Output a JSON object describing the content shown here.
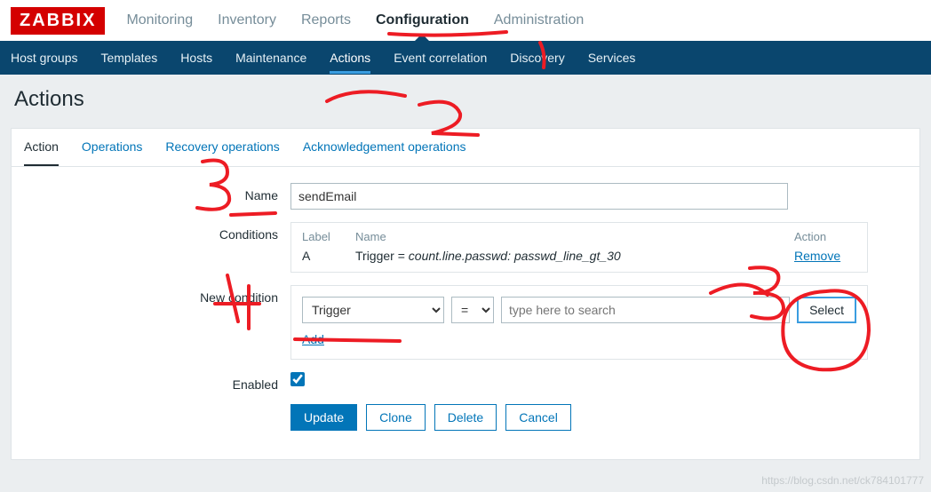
{
  "logo": "ZABBIX",
  "topnav": {
    "items": [
      "Monitoring",
      "Inventory",
      "Reports",
      "Configuration",
      "Administration"
    ],
    "active_index": 3
  },
  "subnav": {
    "items": [
      "Host groups",
      "Templates",
      "Hosts",
      "Maintenance",
      "Actions",
      "Event correlation",
      "Discovery",
      "Services"
    ],
    "active_index": 4
  },
  "page_title": "Actions",
  "tabs": {
    "items": [
      "Action",
      "Operations",
      "Recovery operations",
      "Acknowledgement operations"
    ],
    "active_index": 0
  },
  "form": {
    "name_label": "Name",
    "name_value": "sendEmail",
    "conditions_label": "Conditions",
    "conditions_headers": {
      "label": "Label",
      "name": "Name",
      "action": "Action"
    },
    "conditions": [
      {
        "label": "A",
        "prefix": "Trigger = ",
        "italic": "count.line.passwd: passwd_line_gt_30",
        "action": "Remove"
      }
    ],
    "new_condition_label": "New condition",
    "new_condition": {
      "type_options": [
        "Trigger"
      ],
      "type_value": "Trigger",
      "operator_options": [
        "="
      ],
      "operator_value": "=",
      "search_placeholder": "type here to search",
      "select_label": "Select",
      "add_label": "Add"
    },
    "enabled_label": "Enabled",
    "enabled_value": true,
    "buttons": {
      "update": "Update",
      "clone": "Clone",
      "delete": "Delete",
      "cancel": "Cancel"
    }
  },
  "watermark": "https://blog.csdn.net/ck784101777"
}
